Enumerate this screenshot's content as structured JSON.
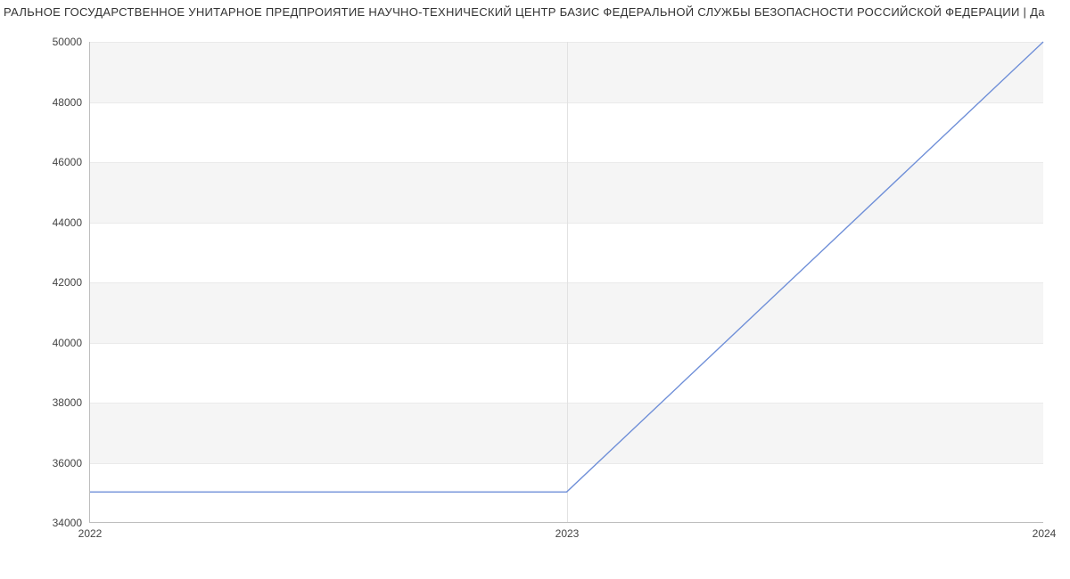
{
  "chart_data": {
    "type": "line",
    "title": "РАЛЬНОЕ ГОСУДАРСТВЕННОЕ УНИТАРНОЕ ПРЕДПРОИЯТИЕ НАУЧНО-ТЕХНИЧЕСКИЙ ЦЕНТР БАЗИС ФЕДЕРАЛЬНОЙ СЛУЖБЫ БЕЗОПАСНОСТИ РОССИЙСКОЙ ФЕДЕРАЦИИ | Да",
    "categories": [
      "2022",
      "2023",
      "2024"
    ],
    "x_ticks": [
      "2022",
      "2023",
      "2024"
    ],
    "y_ticks": [
      34000,
      36000,
      38000,
      40000,
      42000,
      44000,
      46000,
      48000,
      50000
    ],
    "values": [
      35000,
      35000,
      50000
    ],
    "xlabel": "",
    "ylabel": "",
    "xlim": [
      2022,
      2024
    ],
    "ylim": [
      34000,
      50000
    ],
    "line_color": "#6f8fd8"
  }
}
